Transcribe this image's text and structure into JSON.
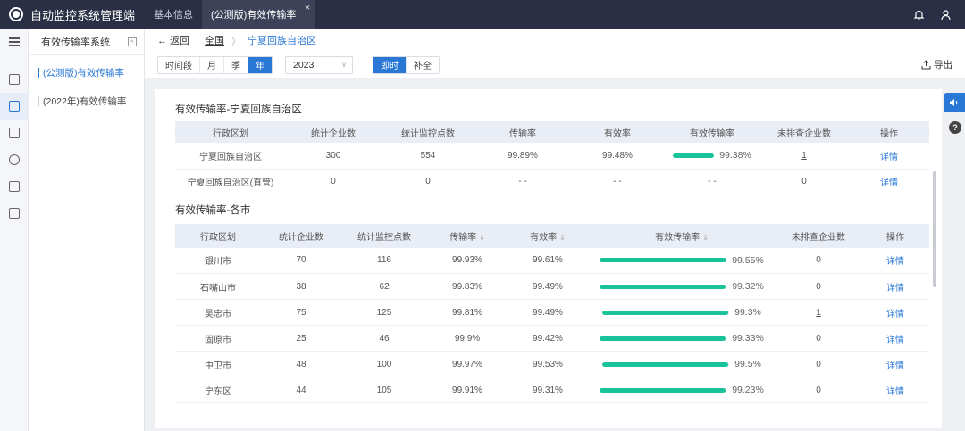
{
  "app": {
    "title": "自动监控系统管理端"
  },
  "tabs": [
    {
      "label": "基本信息"
    },
    {
      "label": "(公测版)有效传输率",
      "close": "×"
    }
  ],
  "sidebar": {
    "title": "有效传输率系统",
    "collapse": "«",
    "items": [
      {
        "label": "(公测版)有效传输率"
      },
      {
        "label": "(2022年)有效传输率"
      }
    ]
  },
  "breadcrumb": {
    "back": "← 返回",
    "root": "全国",
    "arrow": "〉",
    "current": "宁夏回族自治区"
  },
  "toolbar": {
    "segments": [
      "时间段",
      "月",
      "季",
      "年"
    ],
    "year": "2023",
    "mode": [
      "即时",
      "补全"
    ],
    "export": "导出"
  },
  "province_table": {
    "title": "有效传输率-宁夏回族自治区",
    "headers": [
      "行政区划",
      "统计企业数",
      "统计监控点数",
      "传输率",
      "有效率",
      "有效传输率",
      "未排查企业数",
      "操作"
    ],
    "rows": [
      {
        "region": "宁夏回族自治区",
        "companies": "300",
        "points": "554",
        "transmission": "99.89%",
        "valid": "99.48%",
        "effective": 0.9938,
        "effective_text": "99.38%",
        "unchecked": "1",
        "action": "详情"
      },
      {
        "region": "宁夏回族自治区(直管)",
        "companies": "0",
        "points": "0",
        "transmission": "- -",
        "valid": "- -",
        "effective_text": "- -",
        "unchecked": "0",
        "action": "详情"
      }
    ]
  },
  "city_table": {
    "title": "有效传输率-各市",
    "headers": [
      "行政区划",
      "统计企业数",
      "统计监控点数",
      "传输率",
      "有效率",
      "有效传输率",
      "未排查企业数",
      "操作"
    ],
    "sort_icon": "⇕",
    "rows": [
      {
        "region": "银川市",
        "companies": "70",
        "points": "116",
        "transmission": "99.93%",
        "valid": "99.61%",
        "effective": 0.9955,
        "effective_text": "99.55%",
        "unchecked": "0",
        "action": "详情"
      },
      {
        "region": "石嘴山市",
        "companies": "38",
        "points": "62",
        "transmission": "99.83%",
        "valid": "99.49%",
        "effective": 0.9932,
        "effective_text": "99.32%",
        "unchecked": "0",
        "action": "详情"
      },
      {
        "region": "吴忠市",
        "companies": "75",
        "points": "125",
        "transmission": "99.81%",
        "valid": "99.49%",
        "effective": 0.993,
        "effective_text": "99.3%",
        "unchecked": "1",
        "action": "详情"
      },
      {
        "region": "固原市",
        "companies": "25",
        "points": "46",
        "transmission": "99.9%",
        "valid": "99.42%",
        "effective": 0.9933,
        "effective_text": "99.33%",
        "unchecked": "0",
        "action": "详情"
      },
      {
        "region": "中卫市",
        "companies": "48",
        "points": "100",
        "transmission": "99.97%",
        "valid": "99.53%",
        "effective": 0.995,
        "effective_text": "99.5%",
        "unchecked": "0",
        "action": "详情"
      },
      {
        "region": "宁东区",
        "companies": "44",
        "points": "105",
        "transmission": "99.91%",
        "valid": "99.31%",
        "effective": 0.9923,
        "effective_text": "99.23%",
        "unchecked": "0",
        "action": "详情"
      }
    ]
  },
  "float_help": "?",
  "colors": {
    "accent": "#2a78d6",
    "progress": "#19c39a",
    "topbar": "#2b2f45"
  }
}
